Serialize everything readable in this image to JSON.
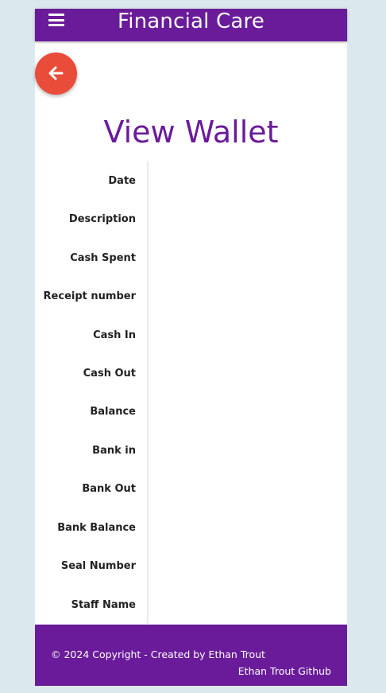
{
  "navbar": {
    "brand": "Financial Care",
    "menu_icon": "hamburger-menu-icon"
  },
  "back_button": {
    "icon": "arrow-left-icon",
    "color": "#ea4c3a"
  },
  "page": {
    "title": "View Wallet"
  },
  "wallet_fields": [
    "Date",
    "Description",
    "Cash Spent",
    "Receipt number",
    "Cash In",
    "Cash Out",
    "Balance",
    "Bank in",
    "Bank Out",
    "Bank Balance",
    "Seal Number",
    "Staff Name"
  ],
  "footer": {
    "copyright": "© 2024 Copyright - Created by Ethan Trout",
    "github_link": "Ethan Trout Github"
  },
  "colors": {
    "primary": "#6a1b9a",
    "background": "#dbe9ef",
    "accent": "#ea4c3a"
  }
}
